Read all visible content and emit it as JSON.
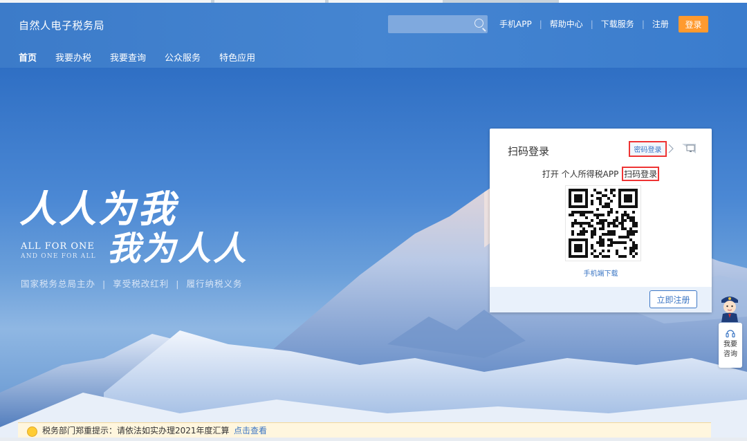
{
  "header": {
    "site_title": "自然人电子税务局",
    "search": {
      "placeholder": "",
      "icon": "search-icon"
    },
    "links": [
      "手机APP",
      "帮助中心",
      "下载服务",
      "注册"
    ],
    "login_label": "登录",
    "login_color": "#ff9a2e"
  },
  "nav": {
    "items": [
      "首页",
      "我要办税",
      "我要查询",
      "公众服务",
      "特色应用"
    ],
    "active_index": 0
  },
  "hero": {
    "slogan_line1": "人人为我",
    "slogan_line2": "我为人人",
    "slogan_en1": "ALL FOR ONE",
    "slogan_en2": "AND ONE FOR ALL",
    "subtitle": [
      "国家税务总局主办",
      "享受税改红利",
      "履行纳税义务"
    ]
  },
  "login_panel": {
    "title": "扫码登录",
    "password_login_label": "密码登录",
    "instruction_prefix": "打开 个人所得税APP ",
    "instruction_highlight": "扫码登录",
    "download_label": "手机端下载",
    "register_label": "立即注册",
    "accent_color": "#3b76c4",
    "highlight_color": "#ee3333"
  },
  "side_widget": {
    "consult_line1": "我要",
    "consult_line2": "咨询",
    "icon": "headset-icon"
  },
  "notice": {
    "text": "税务部门郑重提示：请依法如实办理2021年度汇算",
    "link_label": "点击查看"
  }
}
